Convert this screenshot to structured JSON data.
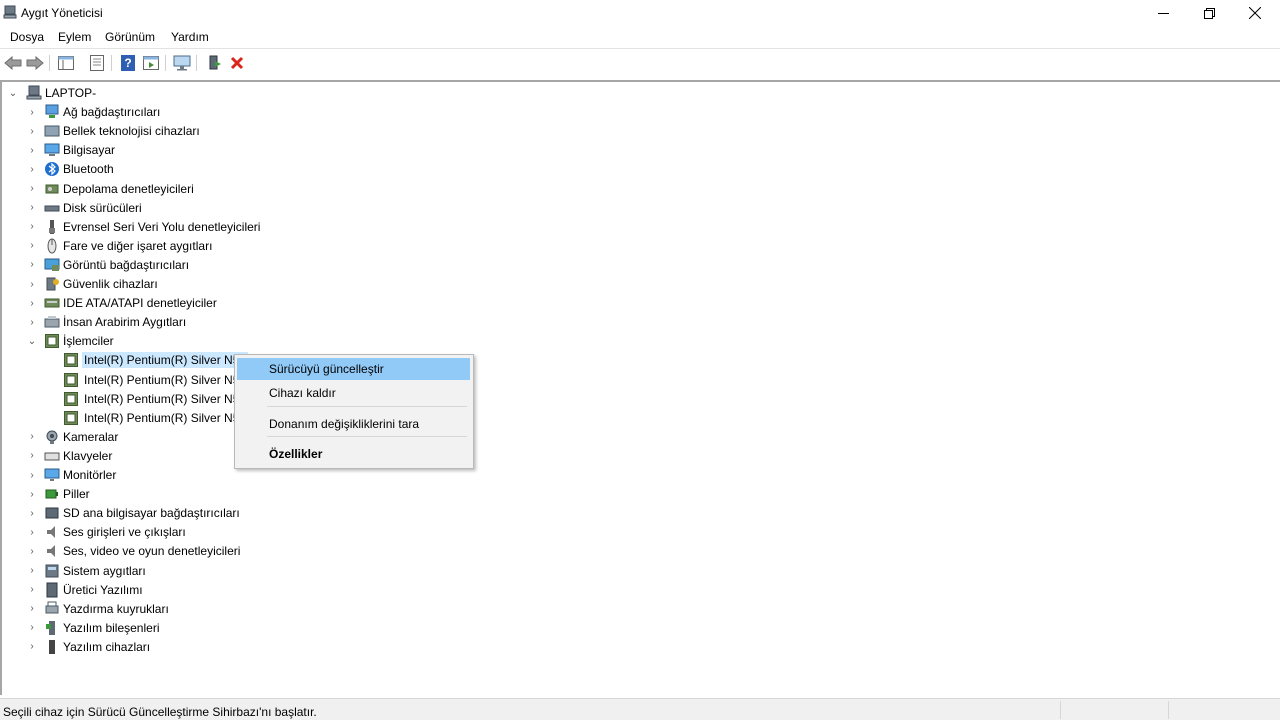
{
  "window": {
    "title": "Aygıt Yöneticisi",
    "controls": {
      "minimize": "—",
      "restore": "❐",
      "close": "✕"
    }
  },
  "menu": {
    "items": [
      "Dosya",
      "Eylem",
      "Görünüm",
      "Yardım"
    ]
  },
  "toolbar": {
    "icons": [
      "back-arrow-icon",
      "forward-arrow-icon",
      "console-tree-icon",
      "properties-sheet-icon",
      "help-icon",
      "action-pane-icon",
      "scan-hardware-icon",
      "update-driver-icon",
      "uninstall-device-icon"
    ],
    "accent_red": "#d9251c",
    "accent_blue": "#2f5fb3"
  },
  "tree": {
    "root": "LAPTOP-",
    "categories": [
      {
        "label": "Ağ bağdaştırıcıları",
        "icon": "network-adapter-icon"
      },
      {
        "label": "Bellek teknolojisi cihazları",
        "icon": "memory-device-icon"
      },
      {
        "label": "Bilgisayar",
        "icon": "computer-icon"
      },
      {
        "label": "Bluetooth",
        "icon": "bluetooth-icon"
      },
      {
        "label": "Depolama denetleyicileri",
        "icon": "storage-controller-icon"
      },
      {
        "label": "Disk sürücüleri",
        "icon": "disk-drive-icon"
      },
      {
        "label": "Evrensel Seri Veri Yolu denetleyicileri",
        "icon": "usb-controller-icon"
      },
      {
        "label": "Fare ve diğer işaret aygıtları",
        "icon": "mouse-icon"
      },
      {
        "label": "Görüntü bağdaştırıcıları",
        "icon": "display-adapter-icon"
      },
      {
        "label": "Güvenlik cihazları",
        "icon": "security-device-icon"
      },
      {
        "label": "IDE ATA/ATAPI denetleyiciler",
        "icon": "ide-controller-icon"
      },
      {
        "label": "İnsan Arabirim Aygıtları",
        "icon": "hid-icon"
      },
      {
        "label": "İşlemciler",
        "icon": "processor-icon",
        "expanded": true,
        "children": [
          "Intel(R) Pentium(R) Silver N50",
          "Intel(R) Pentium(R) Silver N50",
          "Intel(R) Pentium(R) Silver N50",
          "Intel(R) Pentium(R) Silver N50"
        ]
      },
      {
        "label": "Kameralar",
        "icon": "camera-icon"
      },
      {
        "label": "Klavyeler",
        "icon": "keyboard-icon"
      },
      {
        "label": "Monitörler",
        "icon": "monitor-icon"
      },
      {
        "label": "Piller",
        "icon": "battery-icon"
      },
      {
        "label": "SD ana bilgisayar bağdaştırıcıları",
        "icon": "sd-host-icon"
      },
      {
        "label": "Ses girişleri ve çıkışları",
        "icon": "audio-io-icon"
      },
      {
        "label": "Ses, video ve oyun denetleyicileri",
        "icon": "sound-controller-icon"
      },
      {
        "label": "Sistem aygıtları",
        "icon": "system-device-icon"
      },
      {
        "label": "Üretici Yazılımı",
        "icon": "firmware-icon"
      },
      {
        "label": "Yazdırma kuyrukları",
        "icon": "print-queue-icon"
      },
      {
        "label": "Yazılım bileşenleri",
        "icon": "software-component-icon"
      },
      {
        "label": "Yazılım cihazları",
        "icon": "software-device-icon"
      }
    ]
  },
  "context_menu": {
    "items": [
      {
        "label": "Sürücüyü güncelleştir",
        "highlighted": true,
        "bold": false
      },
      {
        "label": "Cihazı kaldır",
        "highlighted": false,
        "bold": false
      },
      {
        "label": "Donanım değişikliklerini tara",
        "highlighted": false,
        "bold": false
      },
      {
        "label": "Özellikler",
        "highlighted": false,
        "bold": true
      }
    ]
  },
  "status": {
    "text": "Seçili cihaz için Sürücü Güncelleştirme Sihirbazı'nı başlatır."
  }
}
